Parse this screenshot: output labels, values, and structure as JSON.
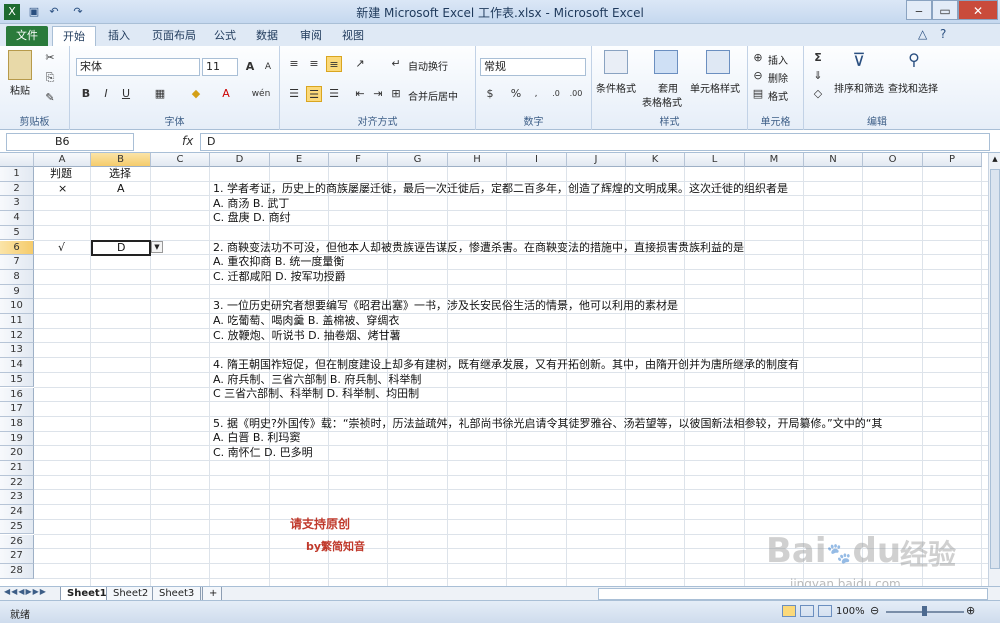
{
  "window": {
    "title": "新建 Microsoft Excel 工作表.xlsx - Microsoft Excel"
  },
  "tabs": [
    "文件",
    "开始",
    "插入",
    "页面布局",
    "公式",
    "数据",
    "审阅",
    "视图"
  ],
  "ribbon": {
    "clipboard": {
      "paste": "粘贴",
      "group": "剪贴板"
    },
    "font": {
      "name": "宋体",
      "size": "11",
      "group": "字体",
      "bold": "B",
      "italic": "I",
      "underline": "U",
      "grow": "A",
      "shrink": "A",
      "fontcolor": "A",
      "phonetic": "wén"
    },
    "alignment": {
      "wrap": "自动换行",
      "merge": "合并后居中",
      "group": "对齐方式"
    },
    "number": {
      "format": "常规",
      "percent": "%",
      "group": "数字"
    },
    "styles": {
      "cond": "条件格式",
      "table1": "套用",
      "table2": "表格格式",
      "cell": "单元格样式",
      "group": "样式"
    },
    "cells": {
      "insert": "插入",
      "delete": "删除",
      "format": "格式",
      "group": "单元格"
    },
    "editing": {
      "sort": "排序和筛选",
      "find": "查找和选择",
      "group": "编辑",
      "sum": "Σ"
    }
  },
  "formula": {
    "namebox": "B6",
    "fx": "fx",
    "content": "D"
  },
  "columns": [
    "A",
    "B",
    "C",
    "D",
    "E",
    "F",
    "G",
    "H",
    "I",
    "J",
    "K",
    "L",
    "M",
    "N",
    "O",
    "P"
  ],
  "rows": [
    "1",
    "2",
    "3",
    "4",
    "5",
    "6",
    "7",
    "8",
    "9",
    "10",
    "11",
    "12",
    "13",
    "14",
    "15",
    "16",
    "17",
    "18",
    "19",
    "20",
    "21",
    "22",
    "23",
    "24",
    "25",
    "26",
    "27",
    "28"
  ],
  "cells": {
    "a1": "判题",
    "b1": "选择",
    "a2": "×",
    "b2": "A",
    "a6": "√",
    "b6": "D",
    "d2": "1. 学者考证，历史上的商族屡屡迁徙，最后一次迁徙后，定都二百多年，创造了辉煌的文明成果。这次迁徙的组织者是",
    "d3": "A. 商汤 B. 武丁",
    "d4": "C. 盘庚 D. 商纣",
    "d6": "2. 商鞅变法功不可没，但他本人却被贵族诬告谋反，惨遭杀害。在商鞅变法的措施中，直接损害贵族利益的是",
    "d7": "A. 重农抑商 B. 统一度量衡",
    "d8": "C. 迁都咸阳 D. 按军功授爵",
    "d10": "3. 一位历史研究者想要编写《昭君出塞》一书，涉及长安民俗生活的情景，他可以利用的素材是",
    "d11": "A. 吃葡萄、喝肉羹 B. 盖棉被、穿绸衣",
    "d12": "C. 放鞭炮、听说书 D. 抽卷烟、烤甘薯",
    "d14": "4. 隋王朝国祚短促，但在制度建设上却多有建树，既有继承发展，又有开拓创新。其中，由隋开创并为唐所继承的制度有",
    "d15": "A. 府兵制、三省六部制 B. 府兵制、科举制",
    "d16": "C 三省六部制、科举制 D. 科举制、均田制",
    "d18": "5. 据《明史?外国传》载：“崇祯时，历法益疏舛，礼部尚书徐光启请令其徒罗雅谷、汤若望等，以彼国新法相参较，开局纂修。”文中的“其",
    "d19": "A. 白晋 B. 利玛窦",
    "d20": "C. 南怀仁 D. 巴多明"
  },
  "watermark": {
    "line1": "请支持原创",
    "line2": "by繁简知音",
    "baidu": "Bai",
    "du": "du",
    "jingyan": "经验",
    "url": "jingyan.baidu.com"
  },
  "sheets": [
    "Sheet1",
    "Sheet2",
    "Sheet3"
  ],
  "status": {
    "ready": "就绪",
    "zoom": "100%"
  }
}
